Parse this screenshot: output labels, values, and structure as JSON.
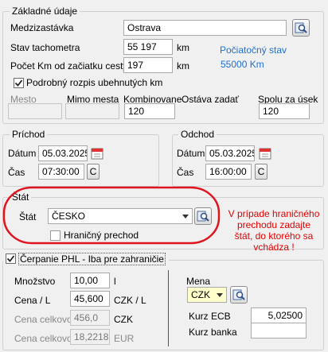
{
  "zakladne": {
    "legend": "Základné údaje",
    "medzizastavka_label": "Medzizastávka",
    "medzizastavka_value": "Ostrava",
    "stav_label": "Stav tachometra",
    "stav_value": "55 197",
    "stav_unit": "km",
    "pociatocny_label": "Počiatočný stav",
    "pociatocny_value": "55000 Km",
    "pocet_label": "Počet Km od začiatku cesty",
    "pocet_value": "197",
    "pocet_unit": "km",
    "podrobny_label": "Podrobný rozpis ubehnutých km",
    "podrobny_checked": true,
    "mesto_label": "Mesto",
    "mimo_label": "Mimo mesta",
    "kombinovane_label": "Kombinovane",
    "kombinovane_value": "120",
    "ostava_label": "Ostáva zadať",
    "spolu_label": "Spolu za úsek",
    "spolu_value": "120"
  },
  "prichod": {
    "legend": "Príchod",
    "datum_label": "Dátum",
    "datum_value": "05.03.2025",
    "cas_label": "Čas",
    "cas_value": "07:30:00",
    "c_button": "C"
  },
  "odchod": {
    "legend": "Odchod",
    "datum_label": "Dátum",
    "datum_value": "05.03.2025",
    "cas_label": "Čas",
    "cas_value": "16:00:00",
    "c_button": "C"
  },
  "stat": {
    "legend": "Štát",
    "label": "Štát",
    "value": "ČESKO",
    "hranicny_label": "Hraničný prechod",
    "hranicny_checked": false,
    "note_line1": "V prípade hraničného",
    "note_line2": "prechodu zadajte",
    "note_line3": "štát, do ktorého sa",
    "note_line4": "vchádza !"
  },
  "cerpanie": {
    "legend": "Čerpanie PHL - Iba pre zahraničie",
    "checked": true,
    "mnozstvo_label": "Množstvo",
    "mnozstvo_value": "10,00",
    "mnozstvo_unit": "l",
    "cena_label": "Cena / L",
    "cena_value": "45,600",
    "cena_unit": "CZK  / L",
    "cena_celkovo_label": "Cena celkovo",
    "cena_celkovo_value": "456,0",
    "cena_celkovo_unit": "CZK",
    "cena_celkovo_eur_label": "Cena celkovo",
    "cena_celkovo_eur_value": "18,2218",
    "cena_celkovo_eur_unit": "EUR",
    "mena_label": "Mena",
    "mena_value": "CZK",
    "kurz_ecb_label": "Kurz ECB",
    "kurz_ecb_value": "5,02500",
    "kurz_banka_label": "Kurz banka",
    "kurz_banka_value": ""
  },
  "colors": {
    "blue_text": "#1f6fc6",
    "red_text": "#e00000",
    "highlight_ellipse": "#e0141e",
    "mena_select_bg": "#ffffcc"
  }
}
